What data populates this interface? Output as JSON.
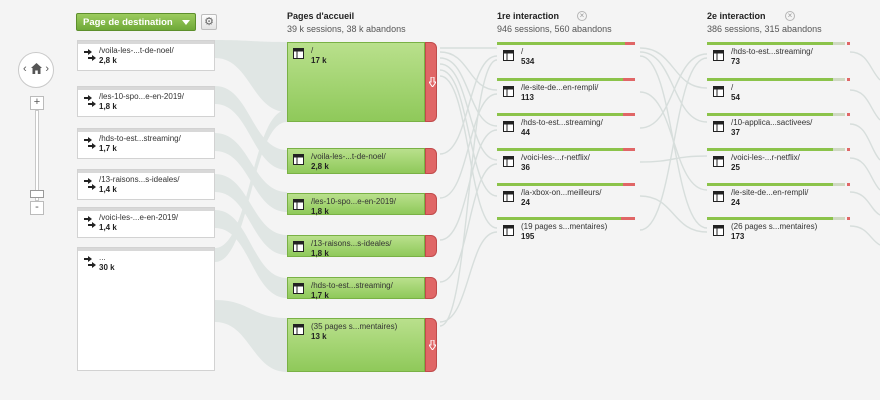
{
  "controls": {
    "dimension_label": "Page de destination",
    "settings_icon": "gear-icon"
  },
  "colors": {
    "accent_green": "#8bc34a",
    "dropoff_red": "#e06666"
  },
  "sources": [
    {
      "label": "/voila-les-...t-de-noel/",
      "value": "2,8 k"
    },
    {
      "label": "/les-10-spo...e-en-2019/",
      "value": "1,8 k"
    },
    {
      "label": "/hds-to-est...streaming/",
      "value": "1,7 k"
    },
    {
      "label": "/13-raisons...s-ideales/",
      "value": "1,4 k"
    },
    {
      "label": "/voici-les-...e-en-2019/",
      "value": "1,4 k"
    },
    {
      "label": "...",
      "value": "30 k"
    }
  ],
  "landing": {
    "title": "Pages d'accueil",
    "subtitle": "39 k sessions, 38 k abandons",
    "nodes": [
      {
        "label": "/",
        "value": "17 k"
      },
      {
        "label": "/voila-les-...t-de-noel/",
        "value": "2,8 k"
      },
      {
        "label": "/les-10-spo...e-en-2019/",
        "value": "1,8 k"
      },
      {
        "label": "/13-raisons...s-ideales/",
        "value": "1,8 k"
      },
      {
        "label": "/hds-to-est...streaming/",
        "value": "1,7 k"
      },
      {
        "label": "(35 pages s...mentaires)",
        "value": "13 k"
      }
    ]
  },
  "interaction1": {
    "title": "1re interaction",
    "subtitle": "946 sessions, 560 abandons",
    "nodes": [
      {
        "label": "/",
        "value": "534"
      },
      {
        "label": "/le-site-de...en-rempli/",
        "value": "113"
      },
      {
        "label": "/hds-to-est...streaming/",
        "value": "44"
      },
      {
        "label": "/voici-les-...r-netflix/",
        "value": "36"
      },
      {
        "label": "/la-xbox-on...meilleurs/",
        "value": "24"
      },
      {
        "label": "(19 pages s...mentaires)",
        "value": "195"
      }
    ]
  },
  "interaction2": {
    "title": "2e interaction",
    "subtitle": "386 sessions, 315 abandons",
    "nodes": [
      {
        "label": "/hds-to-est...streaming/",
        "value": "73"
      },
      {
        "label": "/",
        "value": "54"
      },
      {
        "label": "/10-applica...sactivees/",
        "value": "37"
      },
      {
        "label": "/voici-les-...r-netflix/",
        "value": "25"
      },
      {
        "label": "/le-site-de...en-rempli/",
        "value": "24"
      },
      {
        "label": "(26 pages s...mentaires)",
        "value": "173"
      }
    ]
  }
}
